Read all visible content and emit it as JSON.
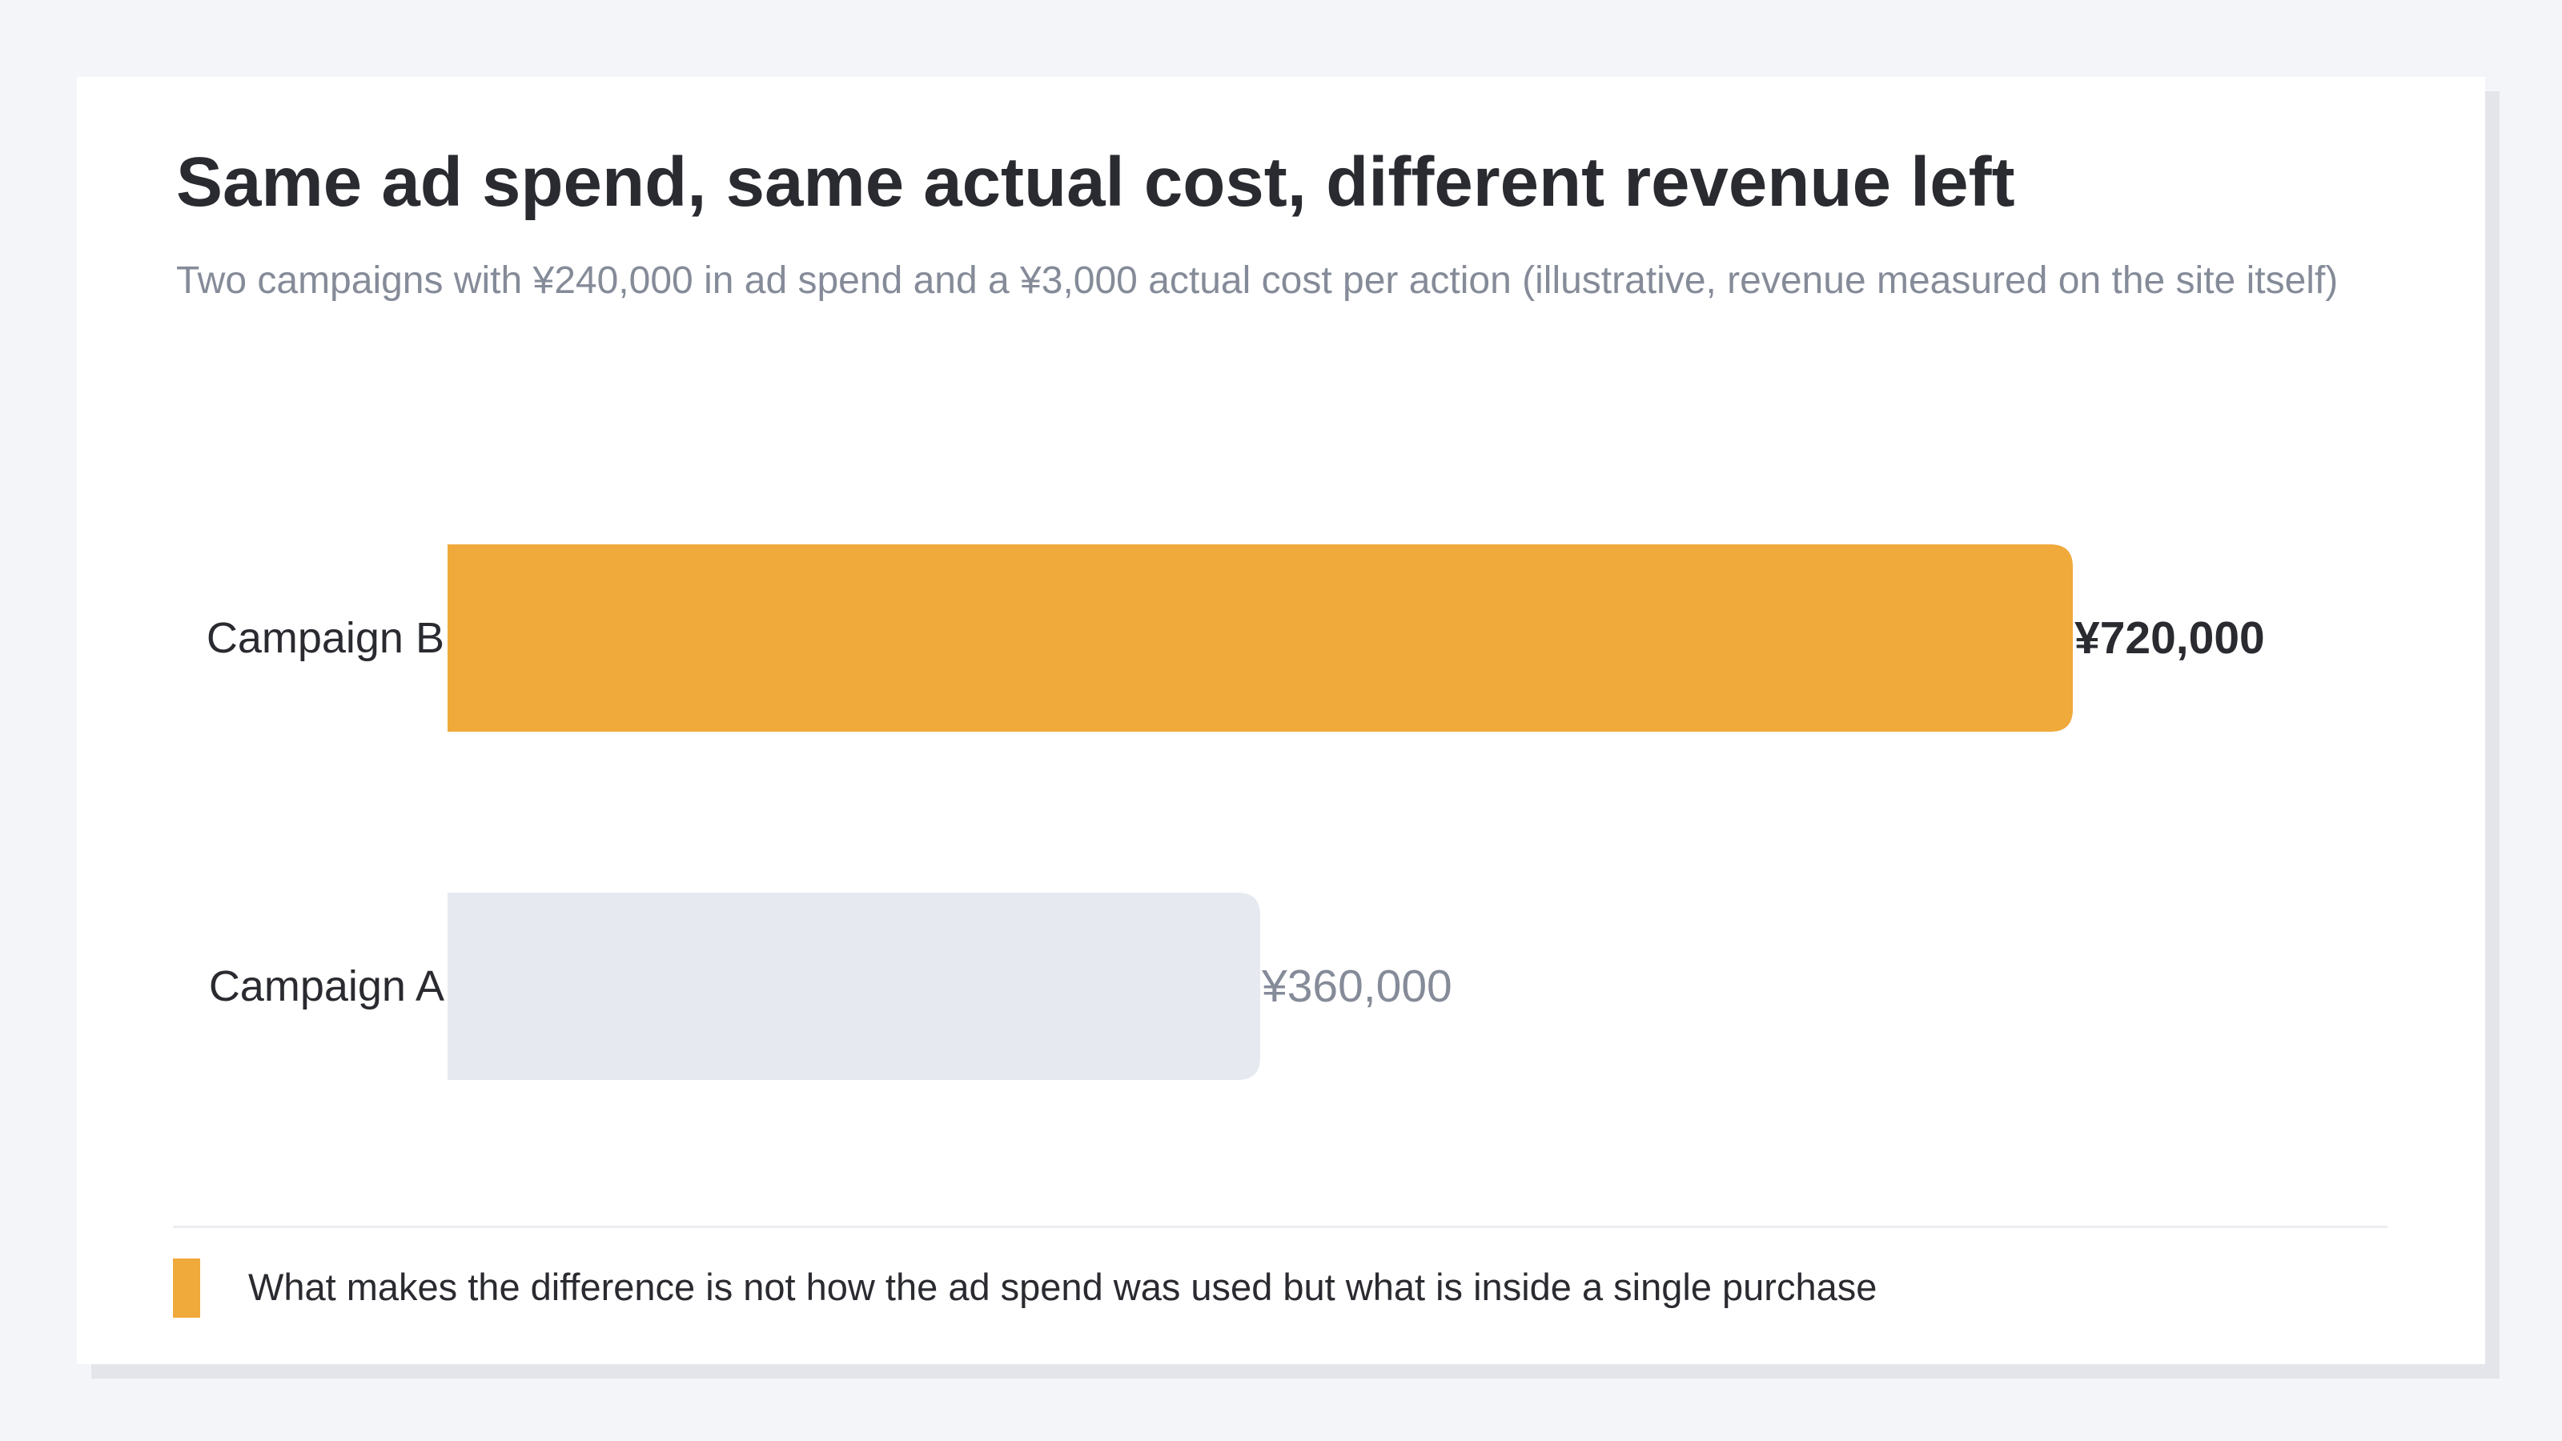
{
  "header": {
    "title": "Same ad spend, same actual cost, different revenue left",
    "subtitle": "Two campaigns with ¥240,000 in ad spend and a ¥3,000 actual cost per action (illustrative, revenue measured on the site itself)"
  },
  "chart_data": {
    "type": "bar",
    "orientation": "horizontal",
    "title": "Same ad spend, same actual cost, different revenue left",
    "subtitle": "Two campaigns with ¥240,000 in ad spend and a ¥3,000 actual cost per action (illustrative, revenue measured on the site itself)",
    "categories": [
      "Campaign B",
      "Campaign A"
    ],
    "values": [
      720000,
      360000
    ],
    "value_labels": [
      "¥720,000",
      "¥360,000"
    ],
    "highlight": "Campaign B",
    "xlim": [
      0,
      720000
    ],
    "grid": false,
    "colors": {
      "highlight_bar": "#f0a93b",
      "muted_bar": "#e6e9f0",
      "highlight_label": "#2a2b30",
      "muted_label": "#858b98",
      "category_label": "#2a2b30"
    }
  },
  "footnote": {
    "text": "What makes the difference is not how the ad spend was used but what is inside a single purchase",
    "swatch_color": "#f0a93b"
  }
}
